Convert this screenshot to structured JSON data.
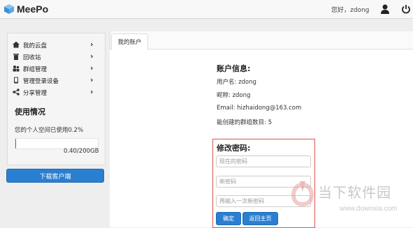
{
  "app": {
    "name": "MeePo"
  },
  "header": {
    "greeting": "您好，zdong"
  },
  "sidebar": {
    "items": [
      {
        "label": "我的云盘",
        "icon": "home-icon"
      },
      {
        "label": "回收站",
        "icon": "trash-icon"
      },
      {
        "label": "群组管理",
        "icon": "group-icon"
      },
      {
        "label": "管理登录设备",
        "icon": "device-icon"
      },
      {
        "label": "分享管理",
        "icon": "share-icon"
      }
    ],
    "usage": {
      "title": "使用情况",
      "text": "您的个人空间已使用0.2%",
      "percent": 0.2,
      "amount": "0.40/200GB"
    },
    "download_label": "下载客户端"
  },
  "tabs": [
    {
      "label": "我的账户"
    }
  ],
  "account": {
    "title": "账户信息:",
    "lines": [
      "用户名: zdong",
      "昵称: zdong",
      "Email: hizhaidong@163.com",
      "能创建的群组数目: 5"
    ]
  },
  "password": {
    "title": "修改密码:",
    "current_placeholder": "现在的密码",
    "new_placeholder": "新密码",
    "confirm_placeholder": "再输入一次新密码",
    "ok_label": "确定",
    "home_label": "返回主页"
  },
  "watermark": {
    "text": "当下软件园",
    "url": "www.downxia.com"
  },
  "colors": {
    "accent": "#2a7fd0",
    "highlight_border": "#d9534f"
  }
}
